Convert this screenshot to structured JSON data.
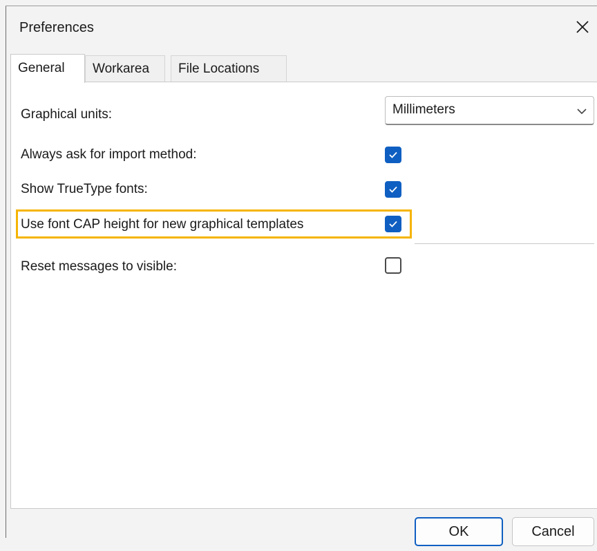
{
  "window": {
    "title": "Preferences"
  },
  "tabs": [
    {
      "label": "General",
      "active": true
    },
    {
      "label": "Workarea",
      "active": false
    },
    {
      "label": "File Locations",
      "active": false
    }
  ],
  "settings": {
    "graphical_units": {
      "label": "Graphical units:",
      "value": "Millimeters"
    },
    "always_ask_import": {
      "label": "Always ask for import method:",
      "checked": true
    },
    "show_truetype_fonts": {
      "label": "Show TrueType fonts:",
      "checked": true
    },
    "use_font_cap_height": {
      "label": "Use font CAP height for new graphical templates",
      "checked": true,
      "highlighted": true
    },
    "reset_messages": {
      "label": "Reset messages to visible:",
      "checked": false
    }
  },
  "buttons": {
    "ok_label": "OK",
    "cancel_label": "Cancel"
  },
  "icons": {
    "close": "close-icon",
    "dropdown": "chevron-down-icon",
    "check": "checkmark-icon"
  },
  "colors": {
    "accent": "#0f5fc2",
    "highlight_border": "#f5b400",
    "window_background": "#f3f3f3",
    "panel_background": "#ffffff"
  }
}
